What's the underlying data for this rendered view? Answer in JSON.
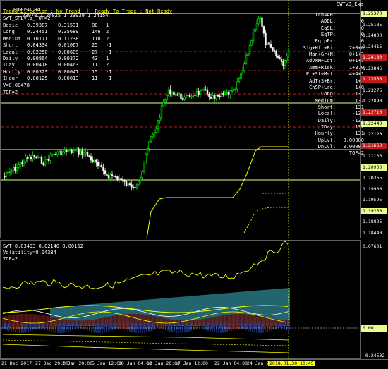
{
  "window": {
    "symbol": "EURUSD,H4",
    "ohlc": "1.23978 1.24025 1.23939 1.24154",
    "expert": "SWTv3_Exp",
    "status_line": "Trend Direction : No Trend  |  Ready To Trade : Not Ready",
    "indicator_title": "SWT_SRLvls_TOF=2"
  },
  "stats_table": [
    {
      "label": "Basic",
      "a": "0.39387",
      "b": "0.31531",
      "c": "80",
      "d": "1"
    },
    {
      "label": "Long",
      "a": "0.24451",
      "b": "0.35689",
      "c": "146",
      "d": "2"
    },
    {
      "label": "Medium",
      "a": "0.10171",
      "b": "0.11238",
      "c": "110",
      "d": "2"
    },
    {
      "label": "Short",
      "a": "0.04334",
      "b": "0.01067",
      "c": "25",
      "d": "-1"
    },
    {
      "label": "Local",
      "a": "0.02250",
      "b": "0.00609",
      "c": "27",
      "d": "-1"
    },
    {
      "label": "Daily",
      "a": "0.00864",
      "b": "0.00372",
      "c": "43",
      "d": "1"
    },
    {
      "label": "IDay",
      "a": "0.00418",
      "b": "0.00463",
      "c": "111",
      "d": "2"
    },
    {
      "label": "Hourly",
      "a": "0.00323",
      "b": "0.00047",
      "c": "15",
      "d": "-1"
    },
    {
      "label": "IHour",
      "a": "0.00125",
      "b": "0.00013",
      "c": "11",
      "d": "-1"
    }
  ],
  "v_line": "V=0.00478",
  "tof_line": "TOF=2",
  "right_panel": [
    {
      "label": "IchAAB:",
      "value": "1"
    },
    {
      "label": "ADDL:",
      "value": "0"
    },
    {
      "label": "EqSL:",
      "value": "0"
    },
    {
      "label": "EqTP:",
      "value": "0"
    },
    {
      "label": "EqtpPr:",
      "value": "0"
    },
    {
      "label": "Sig+Hft+Bi:",
      "value": "2+0+0"
    },
    {
      "label": "Man+Gr+N:",
      "value": "0+1+2"
    },
    {
      "label": "AdvMM+Lot:",
      "value": "0+1+0"
    },
    {
      "label": "Amm+Risk:",
      "value": "1+3.0"
    },
    {
      "label": "Pr+St+Mst:",
      "value": "4+4+1"
    },
    {
      "label": "AdTrS+Br:",
      "value": "1+0"
    },
    {
      "label": "ChSP+Lre:",
      "value": "1+0"
    },
    {
      "label": "Long:",
      "value": "132"
    },
    {
      "label": "Medium:",
      "value": "132"
    },
    {
      "label": "Short:",
      "value": "-131"
    },
    {
      "label": "Local:",
      "value": "-131"
    },
    {
      "label": "Daily:",
      "value": "-131"
    },
    {
      "label": "IDay:",
      "value": "132"
    },
    {
      "label": "Hourly:",
      "value": "-131"
    },
    {
      "label": "UpLvl:",
      "value": "0.00000"
    },
    {
      "label": "DnLvl:",
      "value": "0.00000"
    },
    {
      "label": "",
      "value": "TOF=2"
    }
  ],
  "price_axis": {
    "labels": [
      {
        "v": "1.25370",
        "kind": "grn"
      },
      {
        "v": "1.25185",
        "kind": "blk"
      },
      {
        "v": "1.24800",
        "kind": "blk"
      },
      {
        "v": "1.24415",
        "kind": "blk"
      },
      {
        "v": "1.24180",
        "kind": "red"
      },
      {
        "v": "1.23845",
        "kind": "blk"
      },
      {
        "v": "1.23500",
        "kind": "red"
      },
      {
        "v": "1.23275",
        "kind": "blk"
      },
      {
        "v": "1.22890",
        "kind": "blk"
      },
      {
        "v": "1.22710",
        "kind": "red"
      },
      {
        "v": "1.22440",
        "kind": "grn"
      },
      {
        "v": "1.22120",
        "kind": "blk"
      },
      {
        "v": "1.21660",
        "kind": "red"
      },
      {
        "v": "1.21130",
        "kind": "blk"
      },
      {
        "v": "1.20900",
        "kind": "grn"
      },
      {
        "v": "1.20365",
        "kind": "blk"
      },
      {
        "v": "1.19980",
        "kind": "blk"
      },
      {
        "v": "1.19595",
        "kind": "blk"
      },
      {
        "v": "1.19250",
        "kind": "grn"
      },
      {
        "v": "1.18825",
        "kind": "blk"
      },
      {
        "v": "1.18440",
        "kind": "blk"
      }
    ]
  },
  "subwindow": {
    "title": "SWT 0.03493 0.02140 0.00162",
    "volatility": "Volatility=0.04334",
    "tof": "TOF=2",
    "axis": [
      {
        "v": "0.07601",
        "kind": "blk"
      },
      {
        "v": "0.00",
        "kind": "grn"
      },
      {
        "v": "-0.24532",
        "kind": "blk"
      }
    ]
  },
  "time_axis": [
    "21 Dec 2017",
    "27 Dec 20:00",
    "2 Jan 20:00",
    "5 Jan 12:00",
    "10 Jan 04:00",
    "12 Jan 20:00",
    "17 Jan 12:00",
    "22 Jan 04:00",
    "24 Jan 20:00",
    "2018.01.30 10:45"
  ],
  "colors": {
    "background": "#000000",
    "candle_bull": "#00ff00",
    "candle_bear": "#ffffff",
    "level_red": "#c01a1a",
    "level_green": "#e6ff8a",
    "indicator_yellow": "#ffff00",
    "histogram_teal": "#3aa8b8"
  }
}
